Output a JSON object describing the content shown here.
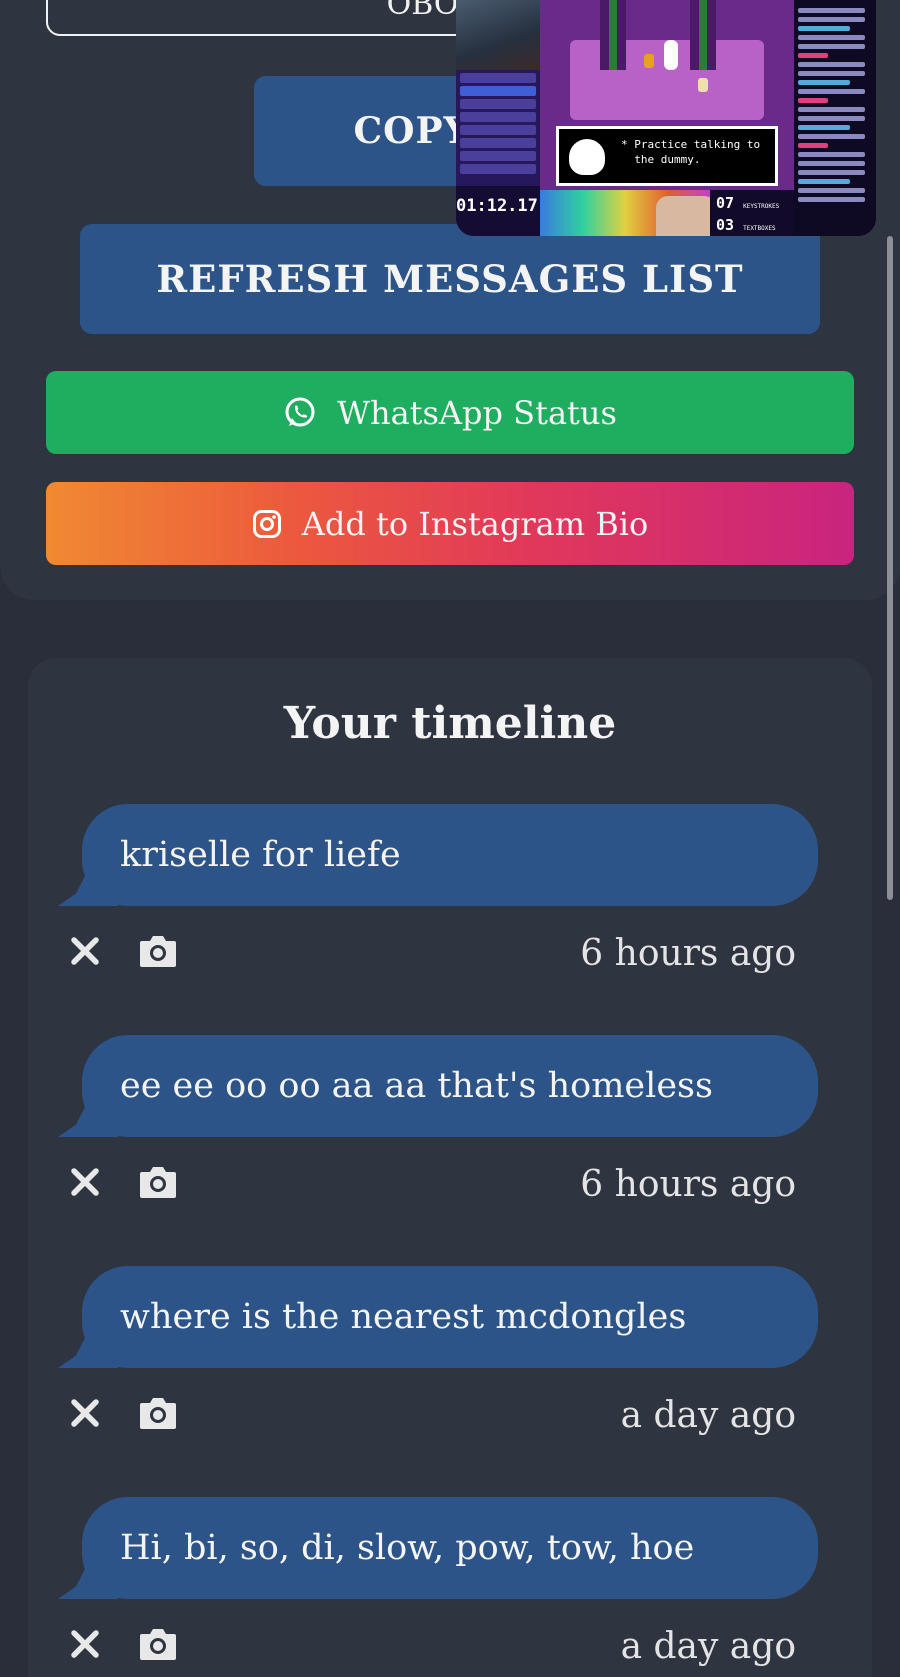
{
  "share": {
    "link_text": "OBO...",
    "copy_label": "COPY TH",
    "refresh_label": "REFRESH MESSAGES LIST",
    "whatsapp_label": "WhatsApp Status",
    "instagram_label": "Add to Instagram Bio"
  },
  "pip_overlay": {
    "timer": "01:12.17",
    "dialog_text": "* Practice talking to\n  the dummy.",
    "counts_top": "07",
    "counts_bottom": "03",
    "keystrokes_label": "KEYSTROKES",
    "textboxes_label": "TEXTBOXES"
  },
  "timeline": {
    "title": "Your timeline",
    "messages": [
      {
        "text": "kriselle for liefe",
        "time": "6 hours ago"
      },
      {
        "text": "ee ee oo oo aa aa that's homeless",
        "time": "6 hours ago"
      },
      {
        "text": "where is the nearest mcdongles",
        "time": "a day ago"
      },
      {
        "text": "Hi, bi, so, di, slow, pow, tow, hoe",
        "time": "a day ago"
      }
    ]
  },
  "icons": {
    "whatsapp": "whatsapp-icon",
    "instagram": "instagram-icon",
    "delete": "close-icon",
    "camera": "camera-icon"
  },
  "colors": {
    "background": "#2a2e3a",
    "card": "#2f3441",
    "primary_button": "#2d5488",
    "whatsapp_green": "#1fae5f",
    "instagram_start": "#f08a32",
    "instagram_end": "#c9247f"
  }
}
